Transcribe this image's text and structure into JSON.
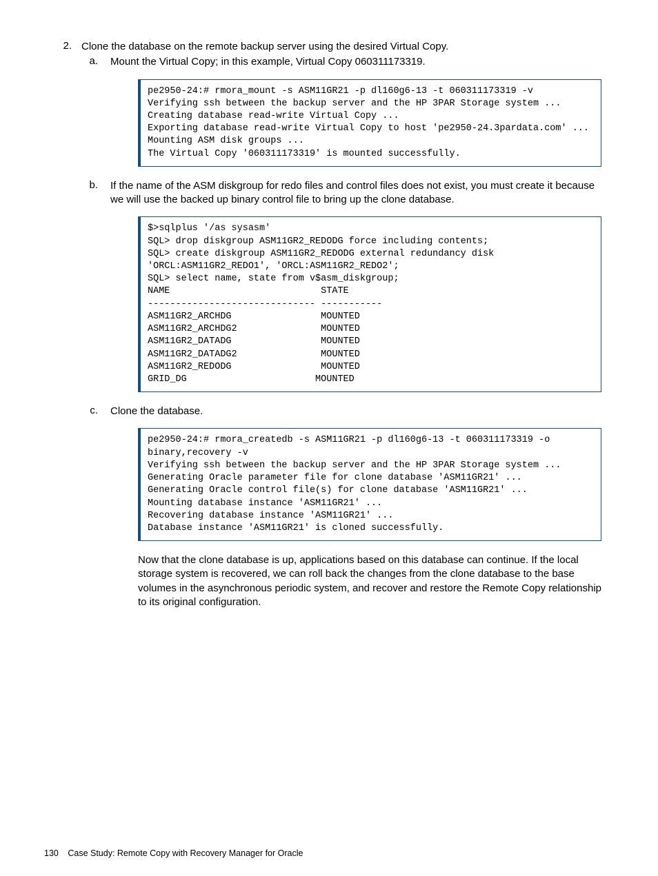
{
  "step2": {
    "marker": "2.",
    "text": "Clone the database on the remote backup server using the desired Virtual Copy."
  },
  "step2a": {
    "marker": "a.",
    "text": "Mount the Virtual Copy; in this example, Virtual Copy 060311173319."
  },
  "code_a": "pe2950-24:# rmora_mount -s ASM11GR21 -p dl160g6-13 -t 060311173319 -v\nVerifying ssh between the backup server and the HP 3PAR Storage system ...\nCreating database read-write Virtual Copy ...\nExporting database read-write Virtual Copy to host 'pe2950-24.3pardata.com' ...\nMounting ASM disk groups ...\nThe Virtual Copy '060311173319' is mounted successfully.",
  "step2b": {
    "marker": "b.",
    "text": "If the name of the ASM diskgroup for redo files and control files does not exist, you must create it because we will use the backed up binary control file to bring up the clone database."
  },
  "code_b": "$>sqlplus '/as sysasm'\nSQL> drop diskgroup ASM11GR2_REDODG force including contents;\nSQL> create diskgroup ASM11GR2_REDODG external redundancy disk\n'ORCL:ASM11GR2_REDO1', 'ORCL:ASM11GR2_REDO2';\nSQL> select name, state from v$asm_diskgroup;\nNAME                           STATE\n------------------------------ -----------\nASM11GR2_ARCHDG                MOUNTED\nASM11GR2_ARCHDG2               MOUNTED\nASM11GR2_DATADG                MOUNTED\nASM11GR2_DATADG2               MOUNTED\nASM11GR2_REDODG                MOUNTED\nGRID_DG                       MOUNTED",
  "step2c": {
    "marker": "c.",
    "text": "Clone the database."
  },
  "code_c": "pe2950-24:# rmora_createdb -s ASM11GR21 -p dl160g6-13 -t 060311173319 -o binary,recovery -v\nVerifying ssh between the backup server and the HP 3PAR Storage system ...\nGenerating Oracle parameter file for clone database 'ASM11GR21' ...\nGenerating Oracle control file(s) for clone database 'ASM11GR21' ...\nMounting database instance 'ASM11GR21' ...\nRecovering database instance 'ASM11GR21' ...\nDatabase instance 'ASM11GR21' is cloned successfully.",
  "closing_para": "Now that the clone database is up, applications based on this database can continue. If the local storage system is recovered, we can roll back the changes from the clone database to the base volumes in the asynchronous periodic system, and recover and restore the Remote Copy relationship to its original configuration.",
  "footer": {
    "page_number": "130",
    "chapter": "Case Study: Remote Copy with Recovery Manager for Oracle"
  }
}
